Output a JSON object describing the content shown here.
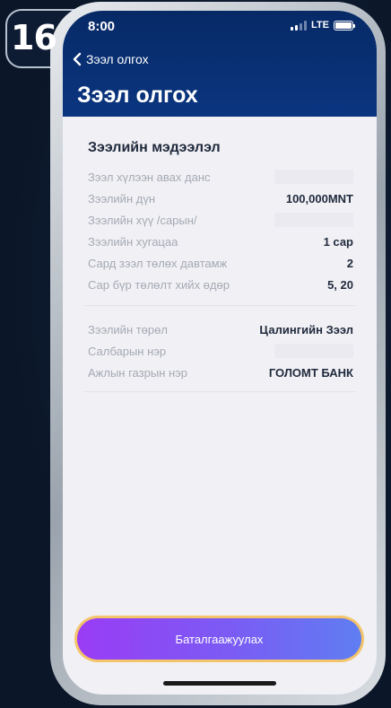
{
  "step_badge": {
    "number": "16"
  },
  "status_bar": {
    "time": "8:00",
    "network": "LTE"
  },
  "header": {
    "back_label": "Зээл олгох",
    "title": "Зээл олгох"
  },
  "loan_info": {
    "section_title": "Зээлийн мэдээлэл",
    "rows": [
      {
        "label": "Зээл хүлээн авах данс",
        "value": ""
      },
      {
        "label": "Зээлийн дүн",
        "value": "100,000MNT"
      },
      {
        "label": "Зээлийн хүү /сарын/",
        "value": ""
      },
      {
        "label": "Зээлийн хугацаа",
        "value": "1 сар"
      },
      {
        "label": "Сард зээл төлөх давтамж",
        "value": "2"
      },
      {
        "label": "Сар бүр төлөлт хийх өдөр",
        "value": "5, 20"
      }
    ]
  },
  "loan_details": {
    "rows": [
      {
        "label": "Зээлийн төрөл",
        "value": "Цалингийн Зээл"
      },
      {
        "label": "Салбарын нэр",
        "value": ""
      },
      {
        "label": "Ажлын газрын нэр",
        "value": "ГОЛОМТ БАНК"
      }
    ]
  },
  "confirm_button": {
    "label": "Баталгаажуулах"
  },
  "colors": {
    "header": "#072a66",
    "button_start": "#9a3cf5",
    "button_end": "#5f7ef2",
    "button_border": "#f3c46a"
  }
}
